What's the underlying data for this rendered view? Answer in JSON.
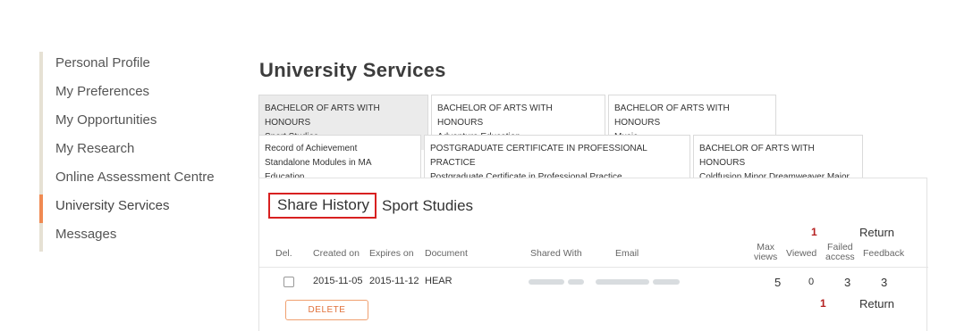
{
  "sidebar": {
    "items": [
      {
        "label": "Personal Profile"
      },
      {
        "label": "My Preferences"
      },
      {
        "label": "My Opportunities"
      },
      {
        "label": "My Research"
      },
      {
        "label": "Online Assessment Centre"
      },
      {
        "label": "University Services",
        "active": true
      },
      {
        "label": "Messages"
      }
    ]
  },
  "page": {
    "title": "University Services"
  },
  "tabs": {
    "row1": [
      {
        "line1": "BACHELOR OF ARTS WITH HONOURS",
        "line2": "Sport Studies",
        "active": true
      },
      {
        "line1": "BACHELOR OF ARTS WITH HONOURS",
        "line2": "Adventure Education"
      },
      {
        "line1": "BACHELOR OF ARTS WITH HONOURS",
        "line2": "Music"
      }
    ],
    "row2": [
      {
        "line1": "Record of Achievement",
        "line2": "Standalone Modules in MA Education"
      },
      {
        "line1": "POSTGRADUATE CERTIFICATE IN PROFESSIONAL PRACTICE",
        "line2": "Postgraduate Certificate in Professional Practice"
      },
      {
        "line1": "BACHELOR OF ARTS WITH HONOURS",
        "line2": "Coldfusion Minor Dreamweaver Major"
      }
    ]
  },
  "share": {
    "heading": "Share History",
    "subheading": "Sport Studies",
    "page_count": "1",
    "return_label": "Return",
    "columns": {
      "del": "Del.",
      "created": "Created on",
      "expires": "Expires on",
      "document": "Document",
      "shared_with": "Shared With",
      "email": "Email",
      "max_views_1": "Max",
      "max_views_2": "views",
      "viewed": "Viewed",
      "failed_1": "Failed",
      "failed_2": "access",
      "feedback": "Feedback"
    },
    "rows": [
      {
        "created": "2015-11-05",
        "expires": "2015-11-12",
        "document": "HEAR",
        "max_views": "5",
        "viewed": "0",
        "failed": "3",
        "feedback": "3"
      }
    ],
    "delete_label": "DELETE"
  },
  "colors": {
    "accent": "#f08a52",
    "highlight_box": "#d82020",
    "count": "#b52020"
  }
}
